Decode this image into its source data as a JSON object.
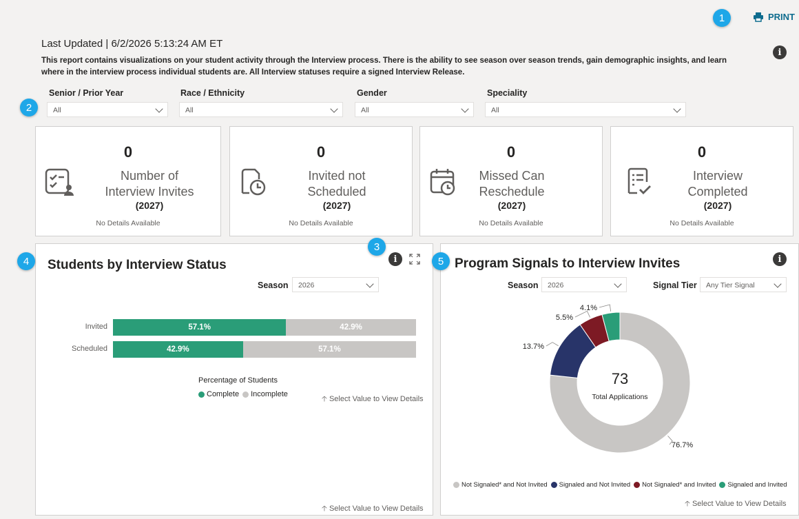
{
  "header": {
    "print_label": "PRINT",
    "last_updated": "Last Updated | 6/2/2026 5:13:24 AM ET",
    "description": "This report contains visualizations on your student activity through the Interview process. There is the ability to see season over season trends, gain demographic insights, and learn where in the interview process individual students are. All Interview statuses require a signed Interview Release."
  },
  "callouts": [
    "1",
    "2",
    "3",
    "4",
    "5"
  ],
  "filters": [
    {
      "label": "Senior / Prior Year",
      "value": "All"
    },
    {
      "label": "Race / Ethnicity",
      "value": "All"
    },
    {
      "label": "Gender",
      "value": "All"
    },
    {
      "label": "Speciality",
      "value": "All"
    }
  ],
  "cards": [
    {
      "value": "0",
      "title_line1": "Number of",
      "title_line2": "Interview Invites",
      "year": "(2027)",
      "note": "No Details Available",
      "icon": "checklist-user-icon"
    },
    {
      "value": "0",
      "title_line1": "Invited not",
      "title_line2": "Scheduled",
      "year": "(2027)",
      "note": "No Details Available",
      "icon": "document-clock-icon"
    },
    {
      "value": "0",
      "title_line1": "Missed Can",
      "title_line2": "Reschedule",
      "year": "(2027)",
      "note": "No Details Available",
      "icon": "calendar-clock-icon"
    },
    {
      "value": "0",
      "title_line1": "Interview",
      "title_line2": "Completed",
      "year": "(2027)",
      "note": "No Details Available",
      "icon": "document-check-icon"
    }
  ],
  "status_panel": {
    "title": "Students by Interview Status",
    "season_label": "Season",
    "season_value": "2026",
    "axis_title": "Percentage of Students",
    "hint": "Select Value to View Details",
    "hint_bottom": "Select Value to View Details",
    "legend": [
      {
        "name": "Complete",
        "color": "#2a9d78"
      },
      {
        "name": "Incomplete",
        "color": "#c8c6c4"
      }
    ],
    "bars": [
      {
        "label": "Invited",
        "complete": 57.1,
        "incomplete": 42.9,
        "complete_text": "57.1%",
        "incomplete_text": "42.9%"
      },
      {
        "label": "Scheduled",
        "complete": 42.9,
        "incomplete": 57.1,
        "complete_text": "42.9%",
        "incomplete_text": "57.1%"
      }
    ]
  },
  "signals_panel": {
    "title": "Program Signals to Interview Invites",
    "season_label": "Season",
    "season_value": "2026",
    "tier_label": "Signal Tier",
    "tier_value": "Any Tier Signal",
    "center_value": "73",
    "center_label": "Total Applications",
    "hint": "Select Value to View Details"
  },
  "chart_data": [
    {
      "type": "bar",
      "orientation": "horizontal-stacked-100",
      "categories": [
        "Invited",
        "Scheduled"
      ],
      "series": [
        {
          "name": "Complete",
          "values": [
            57.1,
            42.9
          ]
        },
        {
          "name": "Incomplete",
          "values": [
            42.9,
            57.1
          ]
        }
      ],
      "xlabel": "Percentage of Students",
      "legend": "bottom"
    },
    {
      "type": "pie",
      "style": "donut",
      "slices": [
        {
          "name": "Not Signaled* and Not Invited",
          "value": 76.7,
          "label": "76.7%",
          "color": "#c8c6c4"
        },
        {
          "name": "Signaled and Not Invited",
          "value": 13.7,
          "label": "13.7%",
          "color": "#283469"
        },
        {
          "name": "Not Signaled* and Invited",
          "value": 5.5,
          "label": "5.5%",
          "color": "#7d1a24"
        },
        {
          "name": "Signaled and Invited",
          "value": 4.1,
          "label": "4.1%",
          "color": "#2a9d78"
        }
      ],
      "center_value": "73",
      "center_label": "Total Applications",
      "legend": "bottom"
    }
  ]
}
